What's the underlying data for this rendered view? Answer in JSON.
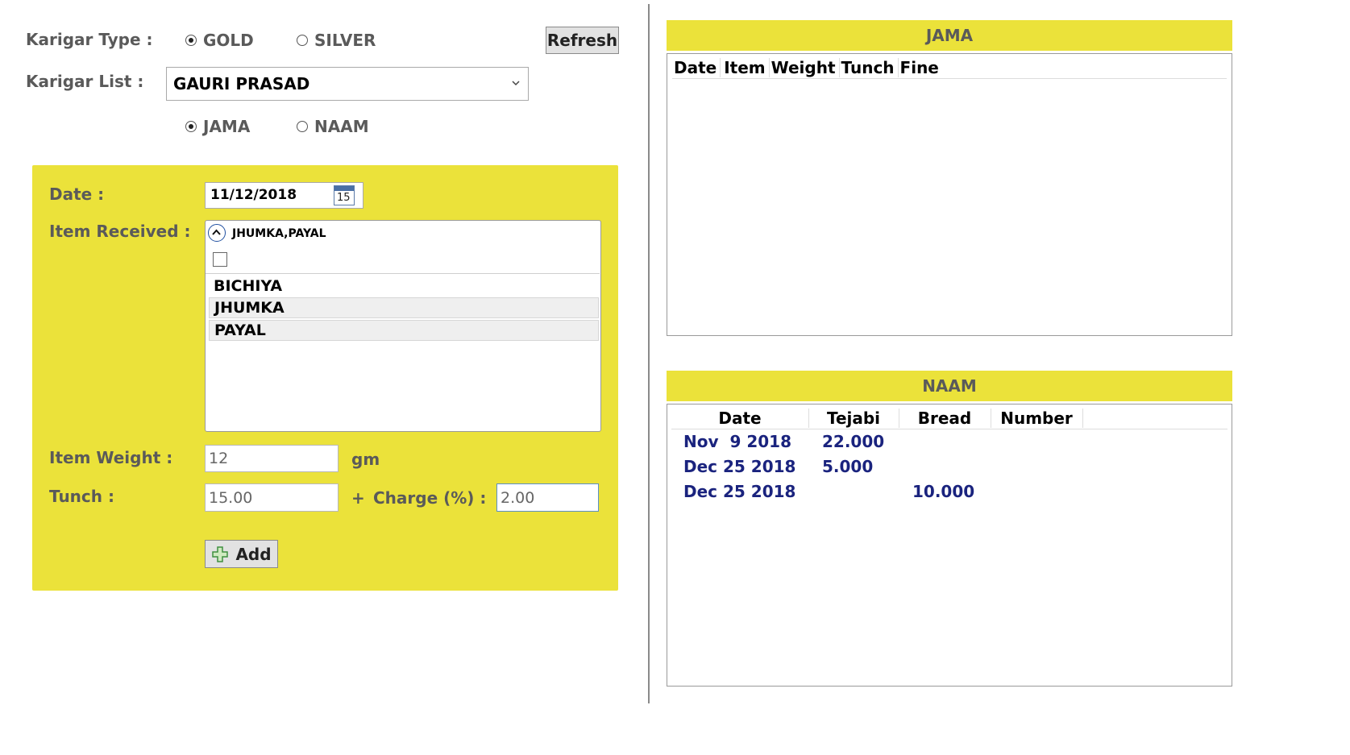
{
  "form": {
    "karigar_type_label": "Karigar Type :",
    "karigar_type_options": [
      {
        "label": "GOLD",
        "selected": true
      },
      {
        "label": "SILVER",
        "selected": false
      }
    ],
    "refresh_label": "Refresh",
    "karigar_list_label": "Karigar List :",
    "karigar_list_value": "GAURI PRASAD",
    "entry_type_options": [
      {
        "label": "JAMA",
        "selected": true
      },
      {
        "label": "NAAM",
        "selected": false
      }
    ]
  },
  "entry": {
    "date_label": "Date :",
    "date_value": "11/12/2018",
    "calendar_day": "15",
    "item_received_label": "Item Received :",
    "item_summary": "JHUMKA,PAYAL",
    "items": [
      {
        "label": "BICHIYA",
        "selected": false
      },
      {
        "label": "JHUMKA",
        "selected": true
      },
      {
        "label": "PAYAL",
        "selected": true
      }
    ],
    "item_weight_label": "Item Weight :",
    "item_weight_value": "12",
    "weight_unit": "gm",
    "tunch_label": "Tunch :",
    "tunch_value": "15.00",
    "plus_sign": "+",
    "charge_label": "Charge (%) :",
    "charge_value": "2.00",
    "add_label": "Add"
  },
  "jama": {
    "title": "JAMA",
    "columns": [
      "Date",
      "Item",
      "Weight",
      "Tunch",
      "Fine"
    ]
  },
  "naam": {
    "title": "NAAM",
    "columns": [
      "Date",
      "Tejabi",
      "Bread",
      "Number"
    ],
    "rows": [
      {
        "date": "Nov  9 2018",
        "tejabi": "22.000",
        "bread": "",
        "number": ""
      },
      {
        "date": "Dec 25 2018",
        "tejabi": "5.000",
        "bread": "",
        "number": ""
      },
      {
        "date": "Dec 25 2018",
        "tejabi": "",
        "bread": "10.000",
        "number": ""
      }
    ]
  },
  "colors": {
    "panel_yellow": "#ebe23a",
    "row_text_navy": "#1a237e",
    "label_gray": "#5a5a5a"
  }
}
